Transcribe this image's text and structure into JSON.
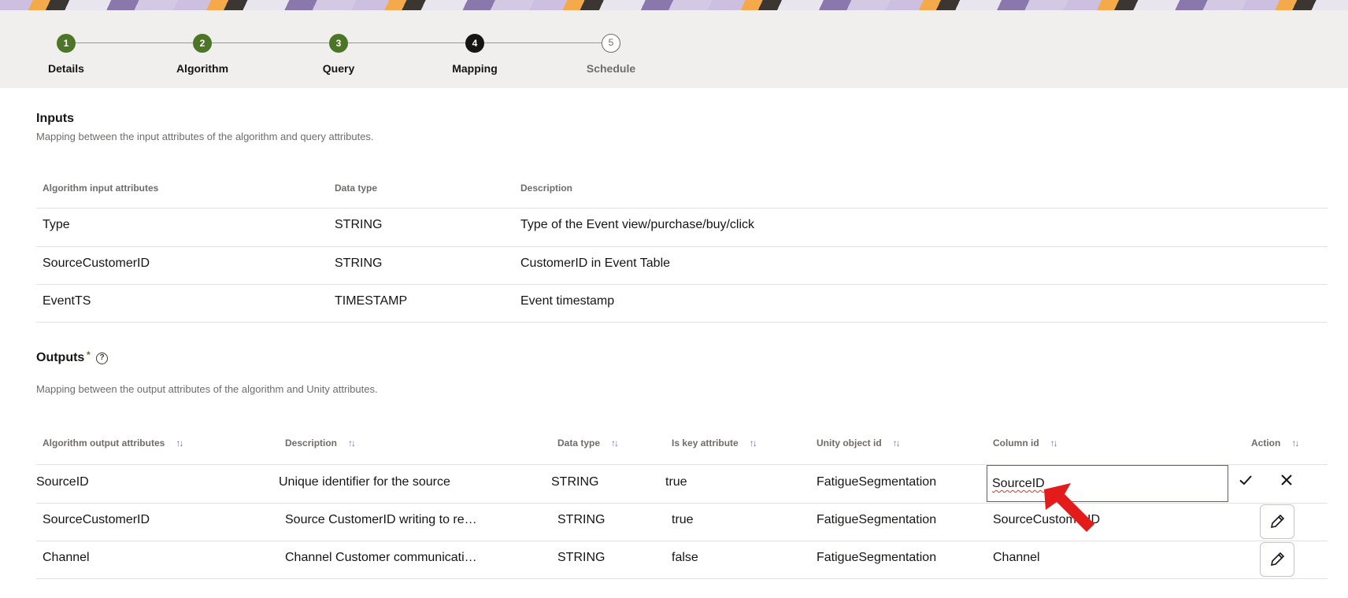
{
  "steps": [
    {
      "number": "1",
      "label": "Details",
      "state": "done"
    },
    {
      "number": "2",
      "label": "Algorithm",
      "state": "done"
    },
    {
      "number": "3",
      "label": "Query",
      "state": "done"
    },
    {
      "number": "4",
      "label": "Mapping",
      "state": "current"
    },
    {
      "number": "5",
      "label": "Schedule",
      "state": "todo"
    }
  ],
  "inputs": {
    "title": "Inputs",
    "description": "Mapping between the input attributes of the algorithm and query attributes.",
    "headers": [
      "Algorithm input attributes",
      "Data type",
      "Description"
    ],
    "rows": [
      [
        "Type",
        "STRING",
        "Type of the Event view/purchase/buy/click"
      ],
      [
        "SourceCustomerID",
        "STRING",
        "CustomerID in Event Table"
      ],
      [
        "EventTS",
        "TIMESTAMP",
        "Event timestamp"
      ]
    ]
  },
  "outputs": {
    "title": "Outputs",
    "required_mark": "*",
    "help_icon": "?",
    "description": "Mapping between the output attributes of the algorithm and Unity attributes.",
    "headers": [
      "Algorithm output attributes",
      "Description",
      "Data type",
      "Is key attribute",
      "Unity object id",
      "Column id",
      "Action"
    ],
    "sort_icon": "↑↓",
    "editing_row": {
      "attribute": "SourceID",
      "description": "Unique identifier for the source",
      "data_type": "STRING",
      "is_key": "true",
      "unity_object": "FatigueSegmentation",
      "column_value": "SourceID"
    },
    "rows": [
      [
        "SourceCustomerID",
        "Source CustomerID writing to re…",
        "STRING",
        "true",
        "FatigueSegmentation",
        "SourceCustomerID"
      ],
      [
        "Channel",
        "Channel Customer communicati…",
        "STRING",
        "false",
        "FatigueSegmentation",
        "Channel"
      ]
    ]
  },
  "icons": {
    "save": "check-icon",
    "cancel": "close-icon",
    "edit": "pencil-icon",
    "pointer": "red-arrow-annotation"
  },
  "colors": {
    "step_done": "#4c7527",
    "step_current": "#161513",
    "input_border": "#4c7527",
    "annotation_arrow": "#e31b1b"
  }
}
